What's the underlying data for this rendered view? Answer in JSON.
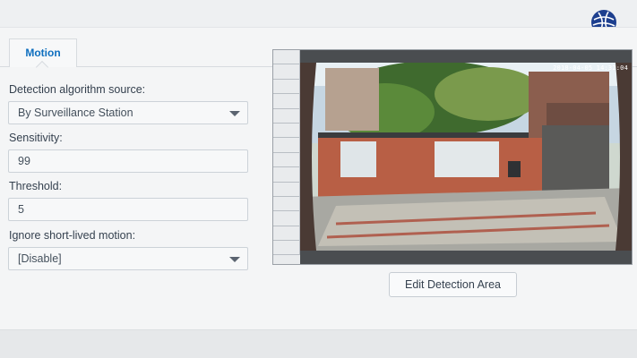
{
  "tabs": [
    {
      "label": "Motion",
      "active": true
    }
  ],
  "form": {
    "algorithm_label": "Detection algorithm source:",
    "algorithm_value": "By Surveillance Station",
    "sensitivity_label": "Sensitivity:",
    "sensitivity_value": "99",
    "threshold_label": "Threshold:",
    "threshold_value": "5",
    "short_lived_label": "Ignore short-lived motion:",
    "short_lived_value": "[Disable]"
  },
  "preview": {
    "timestamp": "2018-04-05 14:32:04"
  },
  "buttons": {
    "edit_detection_area": "Edit Detection Area"
  },
  "colors": {
    "accent": "#0f6fbf",
    "logo": "#1d3f8f"
  },
  "icons": {
    "logo": "globe-logo-icon",
    "dropdown": "chevron-down-icon"
  }
}
